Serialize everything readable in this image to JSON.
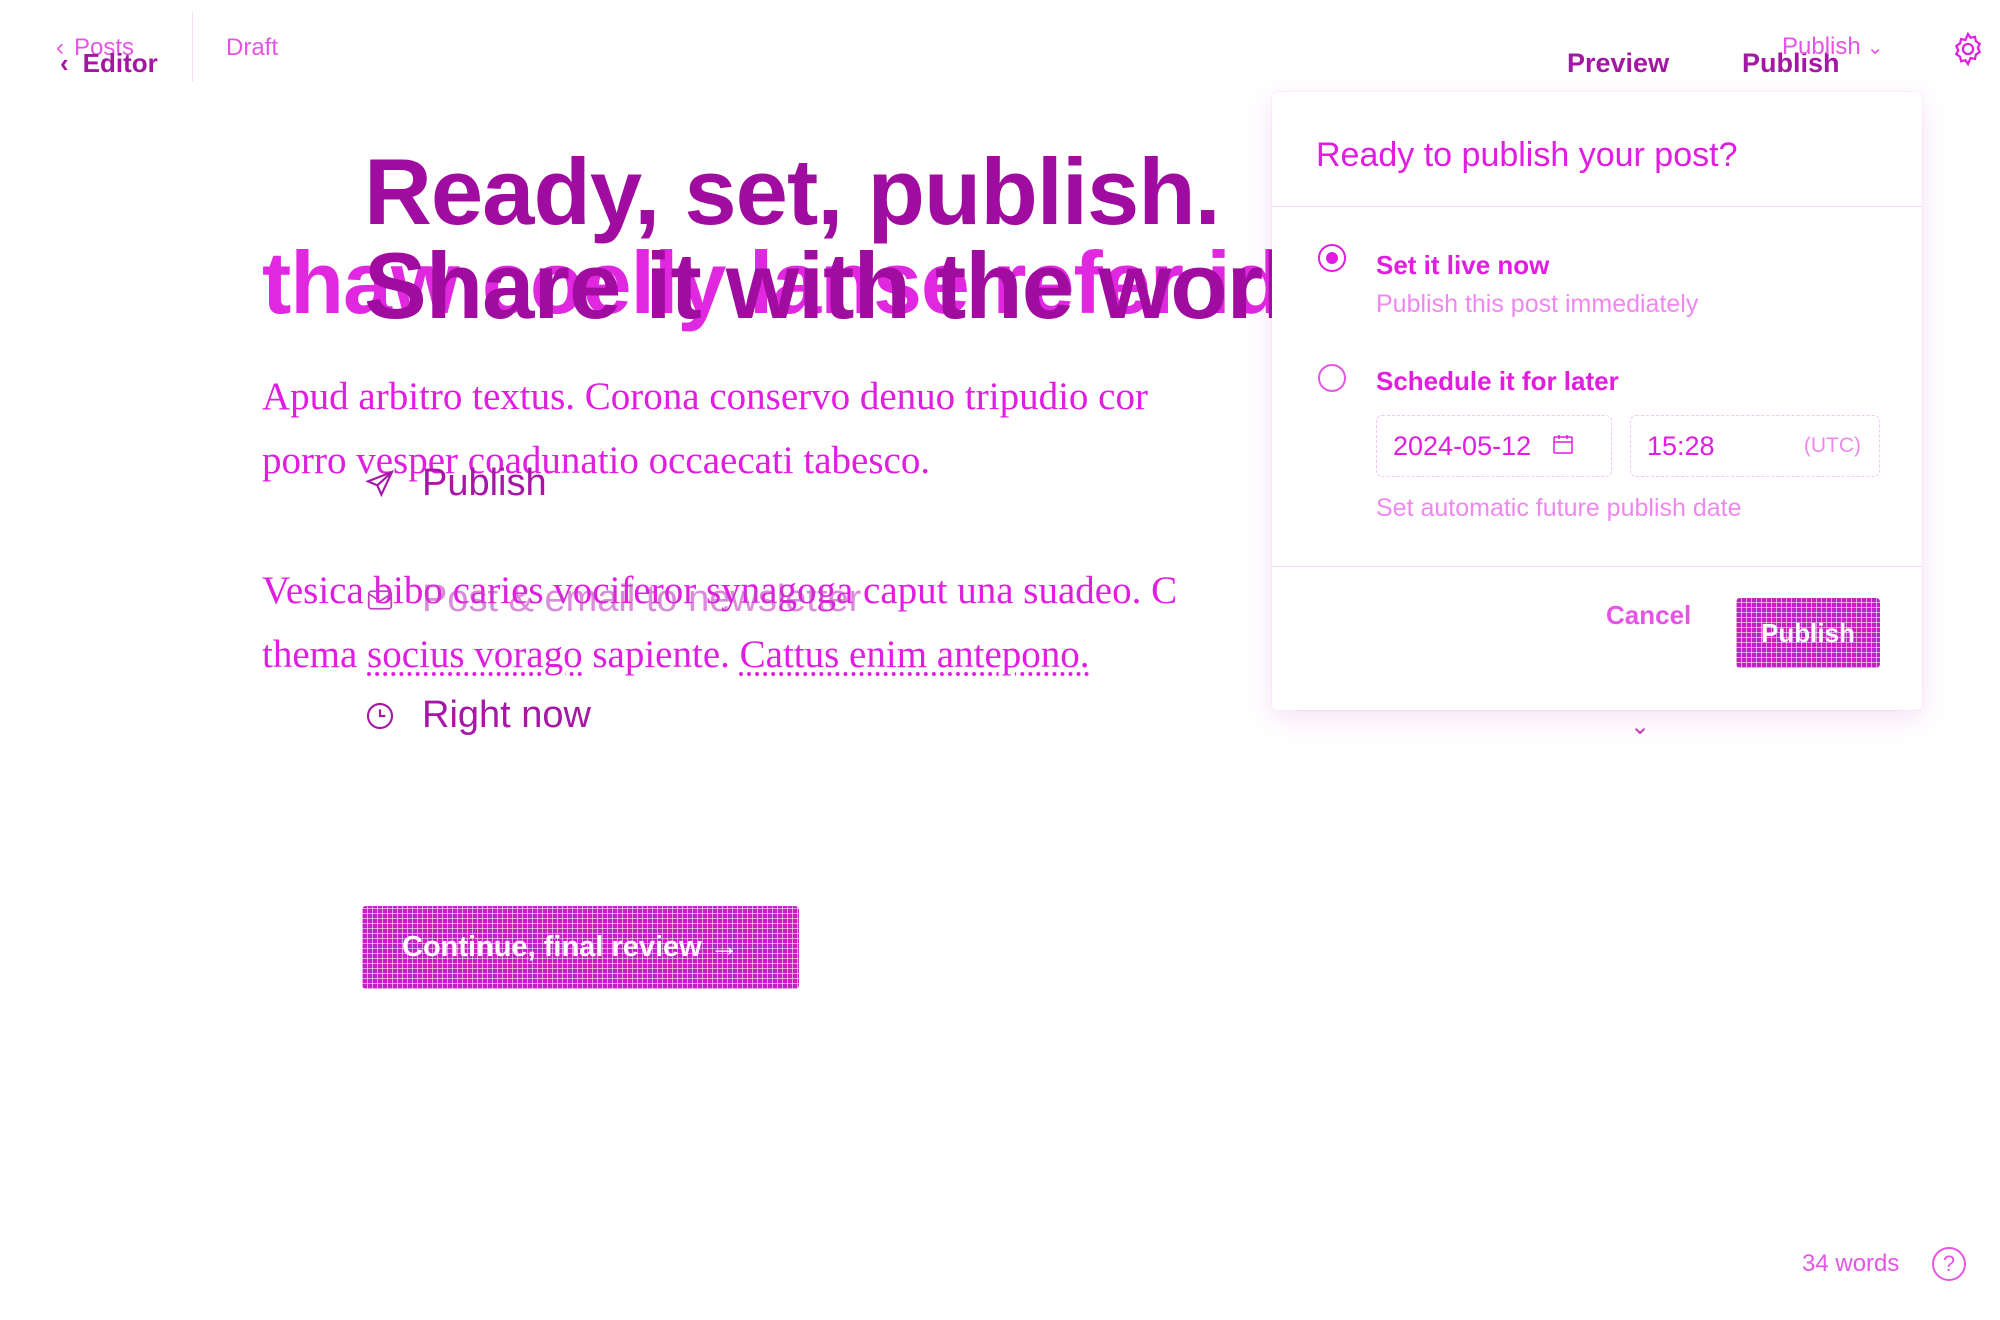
{
  "topbar": {
    "back_posts": "Posts",
    "back_editor": "Editor",
    "status": "Draft",
    "preview": "Preview",
    "publish": "Publish",
    "publish_menu": "Publish"
  },
  "editor": {
    "title": "thaw coelly lanse refer id?",
    "paragraph1_line1": "Apud arbitro textus. Corona conservo denuo tripudio cor",
    "paragraph1_line2": "porro vesper coadunatio occaecati tabesco.",
    "paragraph2_line1": "Vesica bibo caries vociferor synagoga caput una suadeo. C",
    "paragraph2_line2_a": "thema",
    "paragraph2_line2_b": "socius vorago",
    "paragraph2_line2_c": "sapiente.",
    "paragraph2_line2_d": "Cattus enim antepono."
  },
  "publish_flow": {
    "title_line1": "Ready, set, publish.",
    "title_line2": "Share it with the world.",
    "row_publish": "Publish",
    "row_newsletter": "Post & email to newsletter",
    "row_timing": "Right now",
    "continue_label": "Continue, final review →"
  },
  "popover": {
    "heading": "Ready to publish your post?",
    "option_now_title": "Set it live now",
    "option_now_sub": "Publish this post immediately",
    "option_later_title": "Schedule it for later",
    "date_value": "2024-05-12",
    "time_value": "15:28",
    "timezone": "(UTC)",
    "schedule_help": "Set automatic future publish date",
    "cancel": "Cancel",
    "publish": "Publish"
  },
  "footer": {
    "word_count": "34 words"
  }
}
